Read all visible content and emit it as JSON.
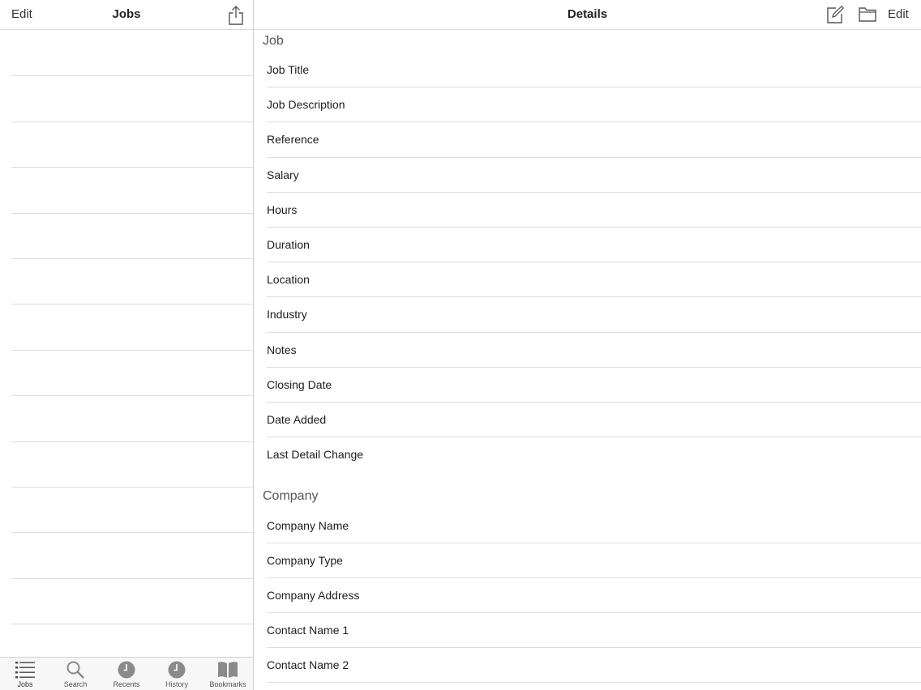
{
  "left_nav": {
    "edit_label": "Edit",
    "title": "Jobs"
  },
  "right_nav": {
    "title": "Details",
    "edit_label": "Edit"
  },
  "sections": {
    "job": {
      "header": "Job",
      "fields": [
        "Job Title",
        "Job Description",
        "Reference",
        "Salary",
        "Hours",
        "Duration",
        "Location",
        "Industry",
        "Notes",
        "Closing Date",
        "Date Added",
        "Last Detail Change"
      ]
    },
    "company": {
      "header": "Company",
      "fields": [
        "Company Name",
        "Company Type",
        "Company Address",
        "Contact Name 1",
        "Contact Name 2"
      ]
    }
  },
  "tabs": [
    {
      "label": "Jobs",
      "icon": "list-icon"
    },
    {
      "label": "Search",
      "icon": "search-icon"
    },
    {
      "label": "Recents",
      "icon": "clock-icon"
    },
    {
      "label": "History",
      "icon": "clock-icon"
    },
    {
      "label": "Bookmarks",
      "icon": "book-icon"
    }
  ],
  "colors": {
    "tab_icon": "#8a8a8a",
    "tab_icon_active": "#444444",
    "separator": "#dcdcdc"
  }
}
